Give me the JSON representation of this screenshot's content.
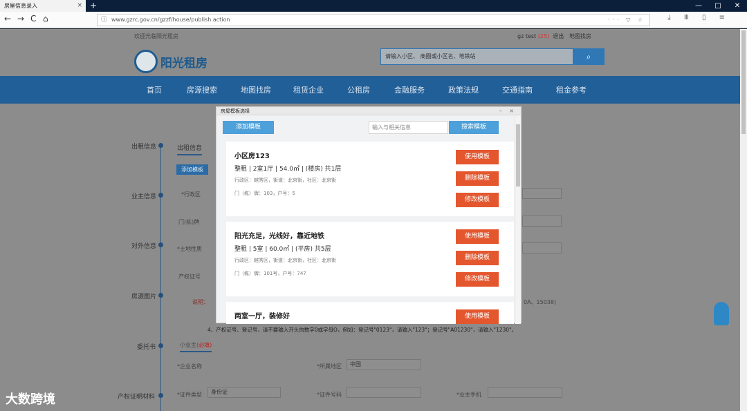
{
  "browser": {
    "tab_title": "房屋信息录入",
    "tab_close": "×",
    "new_tab": "+",
    "win_controls": [
      "—",
      "□",
      "✕"
    ],
    "nav_buttons": [
      "←",
      "→",
      "C",
      "⌂"
    ],
    "url": "www.gzrc.gov.cn/gzzf/house/publish.action",
    "url_tools": "··· ▽ ☆",
    "right_tools": "⤓ Ⅲ ▯ ≡"
  },
  "site": {
    "welcome": "欢迎光临阳光租房",
    "user": "gz test",
    "user_count": "(25)",
    "logout": "退出",
    "sitemap": "地图找房",
    "logo_text": "阳光租房",
    "search_placeholder": "请输入小区、 商圈或小区名、地铁站",
    "search_icon": "magnifier-icon",
    "nav": [
      "首页",
      "房源搜索",
      "地图找房",
      "租赁企业",
      "公租房",
      "金融服务",
      "政策法规",
      "交通指南",
      "租金参考"
    ]
  },
  "form": {
    "side": [
      "出租信息",
      "业主信息",
      "对外信息",
      "房源图片",
      "委托书",
      "产权证明材料"
    ],
    "tab": "出租信息",
    "tab2": "小业主",
    "tab2_extra": "(必填)",
    "add_template": "添加模板",
    "fields": [
      "*行政区",
      "门(栋)牌",
      "*土地性质",
      "产权证号",
      "*企业名称",
      "*所属地区",
      "*证件类型",
      "*证件号码",
      "*业主手机"
    ],
    "district_value": "中国",
    "cert_value": "身份证",
    "note_label": "说明：",
    "note_text": "4、产权证号、登记号，请不要输入开头的数字0或字母O，例如：登记号\"0123\"，请输入\"123\"；登记号\"A01230\"，请输入\"1230\"。",
    "note_tail": "0A、15038)"
  },
  "modal": {
    "title": "房屋模板选择",
    "controls": "– ×",
    "add_btn": "添加模板",
    "search_placeholder": "输入与相关信息",
    "search_btn": "搜索模板",
    "cards": [
      {
        "title": "小区房123",
        "spec": "整租 | 2室1厅 | 54.0㎡ | (楼房) 共1层",
        "loc": "行政区：越秀区，街道：北京街，社区：北京街",
        "door": "门（栋）牌：103，户号：5",
        "btns": [
          "使用模板",
          "删除模板",
          "修改模板"
        ]
      },
      {
        "title": "阳光充足，光线好，靠近地铁",
        "spec": "整租 | 5室 | 60.0㎡ | (平房) 共5层",
        "loc": "行政区：越秀区，街道：北京街，社区：北京街",
        "door": "门（栋）牌：101号，户号：747",
        "btns": [
          "使用模板",
          "删除模板",
          "修改模板"
        ]
      },
      {
        "title": "两室一厅，装修好",
        "spec": "",
        "loc": "",
        "door": "",
        "btns": [
          "使用模板"
        ]
      }
    ]
  },
  "watermark": "大数跨境"
}
